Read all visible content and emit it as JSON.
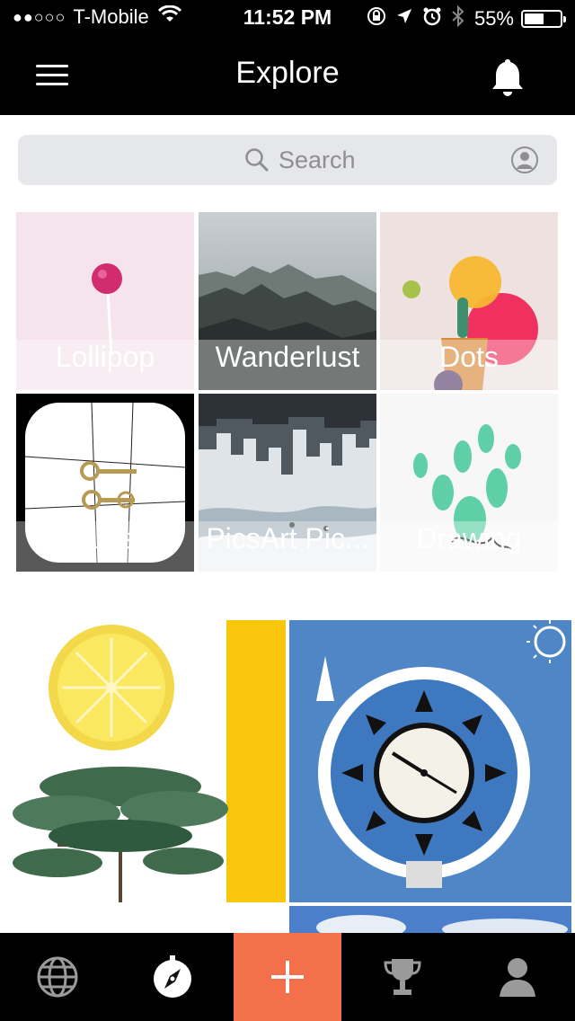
{
  "status_bar": {
    "signal_dots": "●●○○○",
    "carrier": "T-Mobile",
    "time": "11:52 PM",
    "battery_percent": "55%",
    "battery_level": 0.55
  },
  "navbar": {
    "title": "Explore"
  },
  "search": {
    "placeholder": "Search"
  },
  "categories": [
    {
      "label": "Lollipop"
    },
    {
      "label": "Wanderlust"
    },
    {
      "label": "Dots"
    },
    {
      "label": "Latest"
    },
    {
      "label": "PicsArt Pic..."
    },
    {
      "label": "Drawing"
    }
  ],
  "colors": {
    "bars": "#000000",
    "create_accent": "#f2704a",
    "search_bg": "#e6e7ea",
    "placeholder": "#8e8e93"
  },
  "tabbar": {
    "tabs": [
      {
        "icon": "globe-icon"
      },
      {
        "icon": "compass-icon",
        "active": true
      },
      {
        "icon": "plus-icon"
      },
      {
        "icon": "trophy-icon"
      },
      {
        "icon": "profile-icon"
      }
    ]
  }
}
